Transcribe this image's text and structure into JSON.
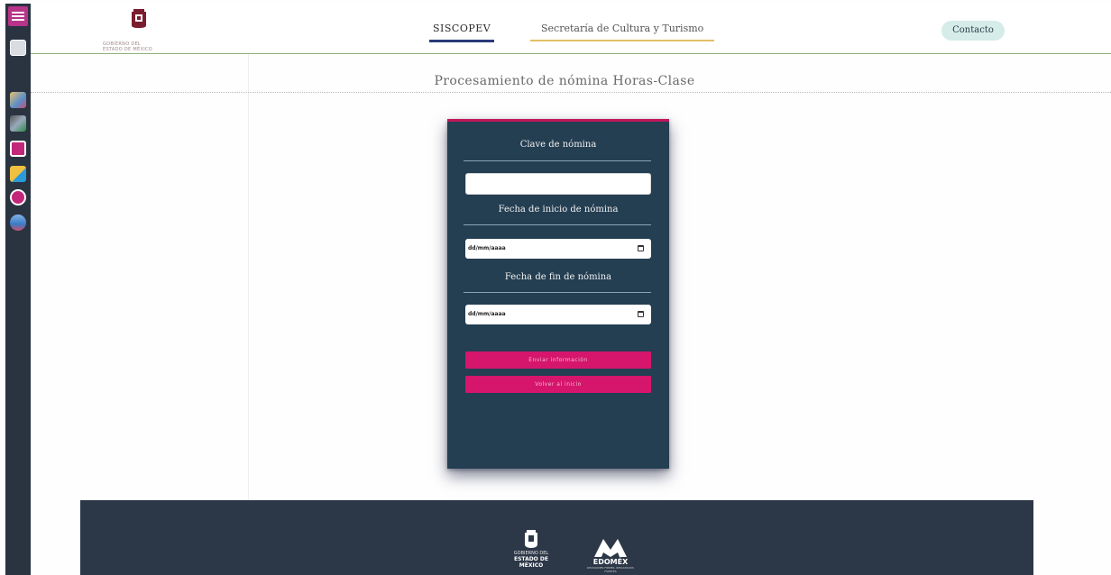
{
  "header": {
    "brand_text_1": "GOBIERNO DEL",
    "brand_text_2": "ESTADO DE MÉXICO",
    "nav": [
      "SISCOPEV",
      "Secretaría de Cultura y Turismo"
    ],
    "contact_label": "Contacto"
  },
  "page_title": "Procesamiento de nómina Horas-Clase",
  "form": {
    "clave_label": "Clave de nómina",
    "clave_value": "",
    "fecha_inicio_label": "Fecha de inicio de nómina",
    "fecha_inicio_value": "dd/mm/aaaa",
    "fecha_fin_label": "Fecha de fin de nómina",
    "fecha_fin_value": "dd/mm/aaaa",
    "primary_button": "Enviar información",
    "secondary_button": "Volver al inicio"
  },
  "footer": {
    "gob_line1": "GOBIERNO DEL",
    "gob_line2": "ESTADO DE MÉXICO",
    "edomex_name": "EDOMÉX",
    "edomex_tag": "DECISIONES FIRMES, RESULTADOS FUERTES"
  },
  "colors": {
    "card": "#243e52",
    "accent": "#d5166c",
    "footer": "#2c3747",
    "nav_active": "#2a3a7a",
    "nav_secondary": "#e2c068"
  },
  "sidebar_icons": [
    "menu-icon",
    "profile-icon",
    "image-icon",
    "network-icon",
    "grid-icon",
    "lock-icon",
    "back-icon",
    "users-icon"
  ]
}
